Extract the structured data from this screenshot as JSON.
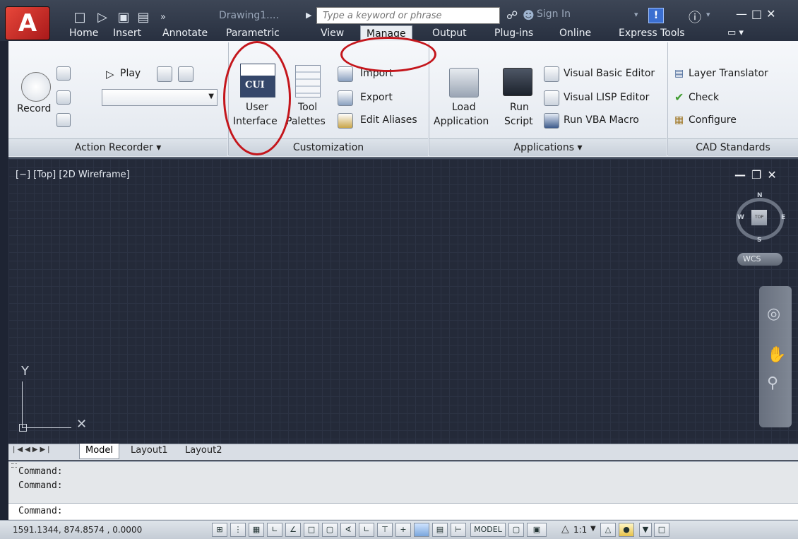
{
  "title_bar": {
    "drawing_name": "Drawing1....",
    "search_placeholder": "Type a keyword or phrase",
    "sign_in": "Sign In"
  },
  "tabs": [
    {
      "label": "Home"
    },
    {
      "label": "Insert"
    },
    {
      "label": "Annotate"
    },
    {
      "label": "Parametric"
    },
    {
      "label": "View"
    },
    {
      "label": "Manage"
    },
    {
      "label": "Output"
    },
    {
      "label": "Plug-ins"
    },
    {
      "label": "Online"
    },
    {
      "label": "Express Tools"
    }
  ],
  "ribbon": {
    "action_recorder": {
      "record": "Record",
      "play": "Play",
      "title": "Action Recorder ▾"
    },
    "customization": {
      "user_interface_line1": "User",
      "user_interface_line2": "Interface",
      "cui_badge": "CUI",
      "tool_line1": "Tool",
      "tool_line2": "Palettes",
      "import": "Import",
      "export": "Export",
      "edit_aliases": "Edit Aliases",
      "title": "Customization"
    },
    "applications": {
      "load_line1": "Load",
      "load_line2": "Application",
      "run_line1": "Run",
      "run_line2": "Script",
      "vb_editor": "Visual Basic Editor",
      "lisp_editor": "Visual LISP Editor",
      "run_vba": "Run VBA Macro",
      "title": "Applications ▾"
    },
    "cad_standards": {
      "layer_translator": "Layer Translator",
      "check": "Check",
      "configure": "Configure",
      "title": "CAD Standards"
    }
  },
  "viewport": {
    "label": "[−] [Top] [2D Wireframe]",
    "compass_n": "N",
    "compass_s": "S",
    "compass_e": "E",
    "compass_w": "W",
    "cube_face": "TOP",
    "wcs": "WCS",
    "ucs_y": "Y"
  },
  "layout_tabs": [
    "Model",
    "Layout1",
    "Layout2"
  ],
  "command": {
    "lines": [
      "Command:",
      "Command:"
    ],
    "prompt": "Command:"
  },
  "status_bar": {
    "coordinates": "1591.1344, 874.8574 , 0.0000",
    "model": "MODEL",
    "scale": "1:1"
  },
  "colors": {
    "annotation_red": "#c4161c",
    "viewport_bg": "#242a39"
  }
}
